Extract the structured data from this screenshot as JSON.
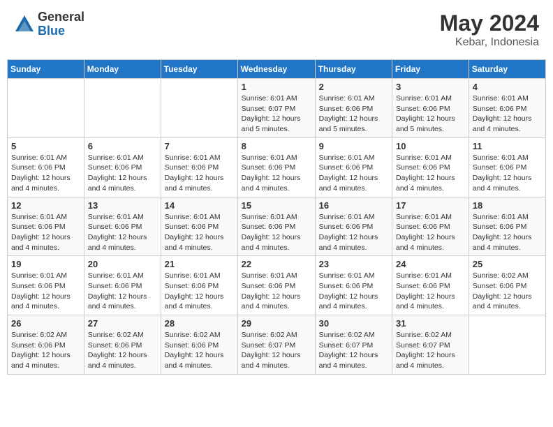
{
  "header": {
    "logo_general": "General",
    "logo_blue": "Blue",
    "month_year": "May 2024",
    "location": "Kebar, Indonesia"
  },
  "weekdays": [
    "Sunday",
    "Monday",
    "Tuesday",
    "Wednesday",
    "Thursday",
    "Friday",
    "Saturday"
  ],
  "weeks": [
    [
      {
        "day": "",
        "detail": ""
      },
      {
        "day": "",
        "detail": ""
      },
      {
        "day": "",
        "detail": ""
      },
      {
        "day": "1",
        "detail": "Sunrise: 6:01 AM\nSunset: 6:07 PM\nDaylight: 12 hours\nand 5 minutes."
      },
      {
        "day": "2",
        "detail": "Sunrise: 6:01 AM\nSunset: 6:06 PM\nDaylight: 12 hours\nand 5 minutes."
      },
      {
        "day": "3",
        "detail": "Sunrise: 6:01 AM\nSunset: 6:06 PM\nDaylight: 12 hours\nand 5 minutes."
      },
      {
        "day": "4",
        "detail": "Sunrise: 6:01 AM\nSunset: 6:06 PM\nDaylight: 12 hours\nand 4 minutes."
      }
    ],
    [
      {
        "day": "5",
        "detail": "Sunrise: 6:01 AM\nSunset: 6:06 PM\nDaylight: 12 hours\nand 4 minutes."
      },
      {
        "day": "6",
        "detail": "Sunrise: 6:01 AM\nSunset: 6:06 PM\nDaylight: 12 hours\nand 4 minutes."
      },
      {
        "day": "7",
        "detail": "Sunrise: 6:01 AM\nSunset: 6:06 PM\nDaylight: 12 hours\nand 4 minutes."
      },
      {
        "day": "8",
        "detail": "Sunrise: 6:01 AM\nSunset: 6:06 PM\nDaylight: 12 hours\nand 4 minutes."
      },
      {
        "day": "9",
        "detail": "Sunrise: 6:01 AM\nSunset: 6:06 PM\nDaylight: 12 hours\nand 4 minutes."
      },
      {
        "day": "10",
        "detail": "Sunrise: 6:01 AM\nSunset: 6:06 PM\nDaylight: 12 hours\nand 4 minutes."
      },
      {
        "day": "11",
        "detail": "Sunrise: 6:01 AM\nSunset: 6:06 PM\nDaylight: 12 hours\nand 4 minutes."
      }
    ],
    [
      {
        "day": "12",
        "detail": "Sunrise: 6:01 AM\nSunset: 6:06 PM\nDaylight: 12 hours\nand 4 minutes."
      },
      {
        "day": "13",
        "detail": "Sunrise: 6:01 AM\nSunset: 6:06 PM\nDaylight: 12 hours\nand 4 minutes."
      },
      {
        "day": "14",
        "detail": "Sunrise: 6:01 AM\nSunset: 6:06 PM\nDaylight: 12 hours\nand 4 minutes."
      },
      {
        "day": "15",
        "detail": "Sunrise: 6:01 AM\nSunset: 6:06 PM\nDaylight: 12 hours\nand 4 minutes."
      },
      {
        "day": "16",
        "detail": "Sunrise: 6:01 AM\nSunset: 6:06 PM\nDaylight: 12 hours\nand 4 minutes."
      },
      {
        "day": "17",
        "detail": "Sunrise: 6:01 AM\nSunset: 6:06 PM\nDaylight: 12 hours\nand 4 minutes."
      },
      {
        "day": "18",
        "detail": "Sunrise: 6:01 AM\nSunset: 6:06 PM\nDaylight: 12 hours\nand 4 minutes."
      }
    ],
    [
      {
        "day": "19",
        "detail": "Sunrise: 6:01 AM\nSunset: 6:06 PM\nDaylight: 12 hours\nand 4 minutes."
      },
      {
        "day": "20",
        "detail": "Sunrise: 6:01 AM\nSunset: 6:06 PM\nDaylight: 12 hours\nand 4 minutes."
      },
      {
        "day": "21",
        "detail": "Sunrise: 6:01 AM\nSunset: 6:06 PM\nDaylight: 12 hours\nand 4 minutes."
      },
      {
        "day": "22",
        "detail": "Sunrise: 6:01 AM\nSunset: 6:06 PM\nDaylight: 12 hours\nand 4 minutes."
      },
      {
        "day": "23",
        "detail": "Sunrise: 6:01 AM\nSunset: 6:06 PM\nDaylight: 12 hours\nand 4 minutes."
      },
      {
        "day": "24",
        "detail": "Sunrise: 6:01 AM\nSunset: 6:06 PM\nDaylight: 12 hours\nand 4 minutes."
      },
      {
        "day": "25",
        "detail": "Sunrise: 6:02 AM\nSunset: 6:06 PM\nDaylight: 12 hours\nand 4 minutes."
      }
    ],
    [
      {
        "day": "26",
        "detail": "Sunrise: 6:02 AM\nSunset: 6:06 PM\nDaylight: 12 hours\nand 4 minutes."
      },
      {
        "day": "27",
        "detail": "Sunrise: 6:02 AM\nSunset: 6:06 PM\nDaylight: 12 hours\nand 4 minutes."
      },
      {
        "day": "28",
        "detail": "Sunrise: 6:02 AM\nSunset: 6:06 PM\nDaylight: 12 hours\nand 4 minutes."
      },
      {
        "day": "29",
        "detail": "Sunrise: 6:02 AM\nSunset: 6:07 PM\nDaylight: 12 hours\nand 4 minutes."
      },
      {
        "day": "30",
        "detail": "Sunrise: 6:02 AM\nSunset: 6:07 PM\nDaylight: 12 hours\nand 4 minutes."
      },
      {
        "day": "31",
        "detail": "Sunrise: 6:02 AM\nSunset: 6:07 PM\nDaylight: 12 hours\nand 4 minutes."
      },
      {
        "day": "",
        "detail": ""
      }
    ]
  ]
}
